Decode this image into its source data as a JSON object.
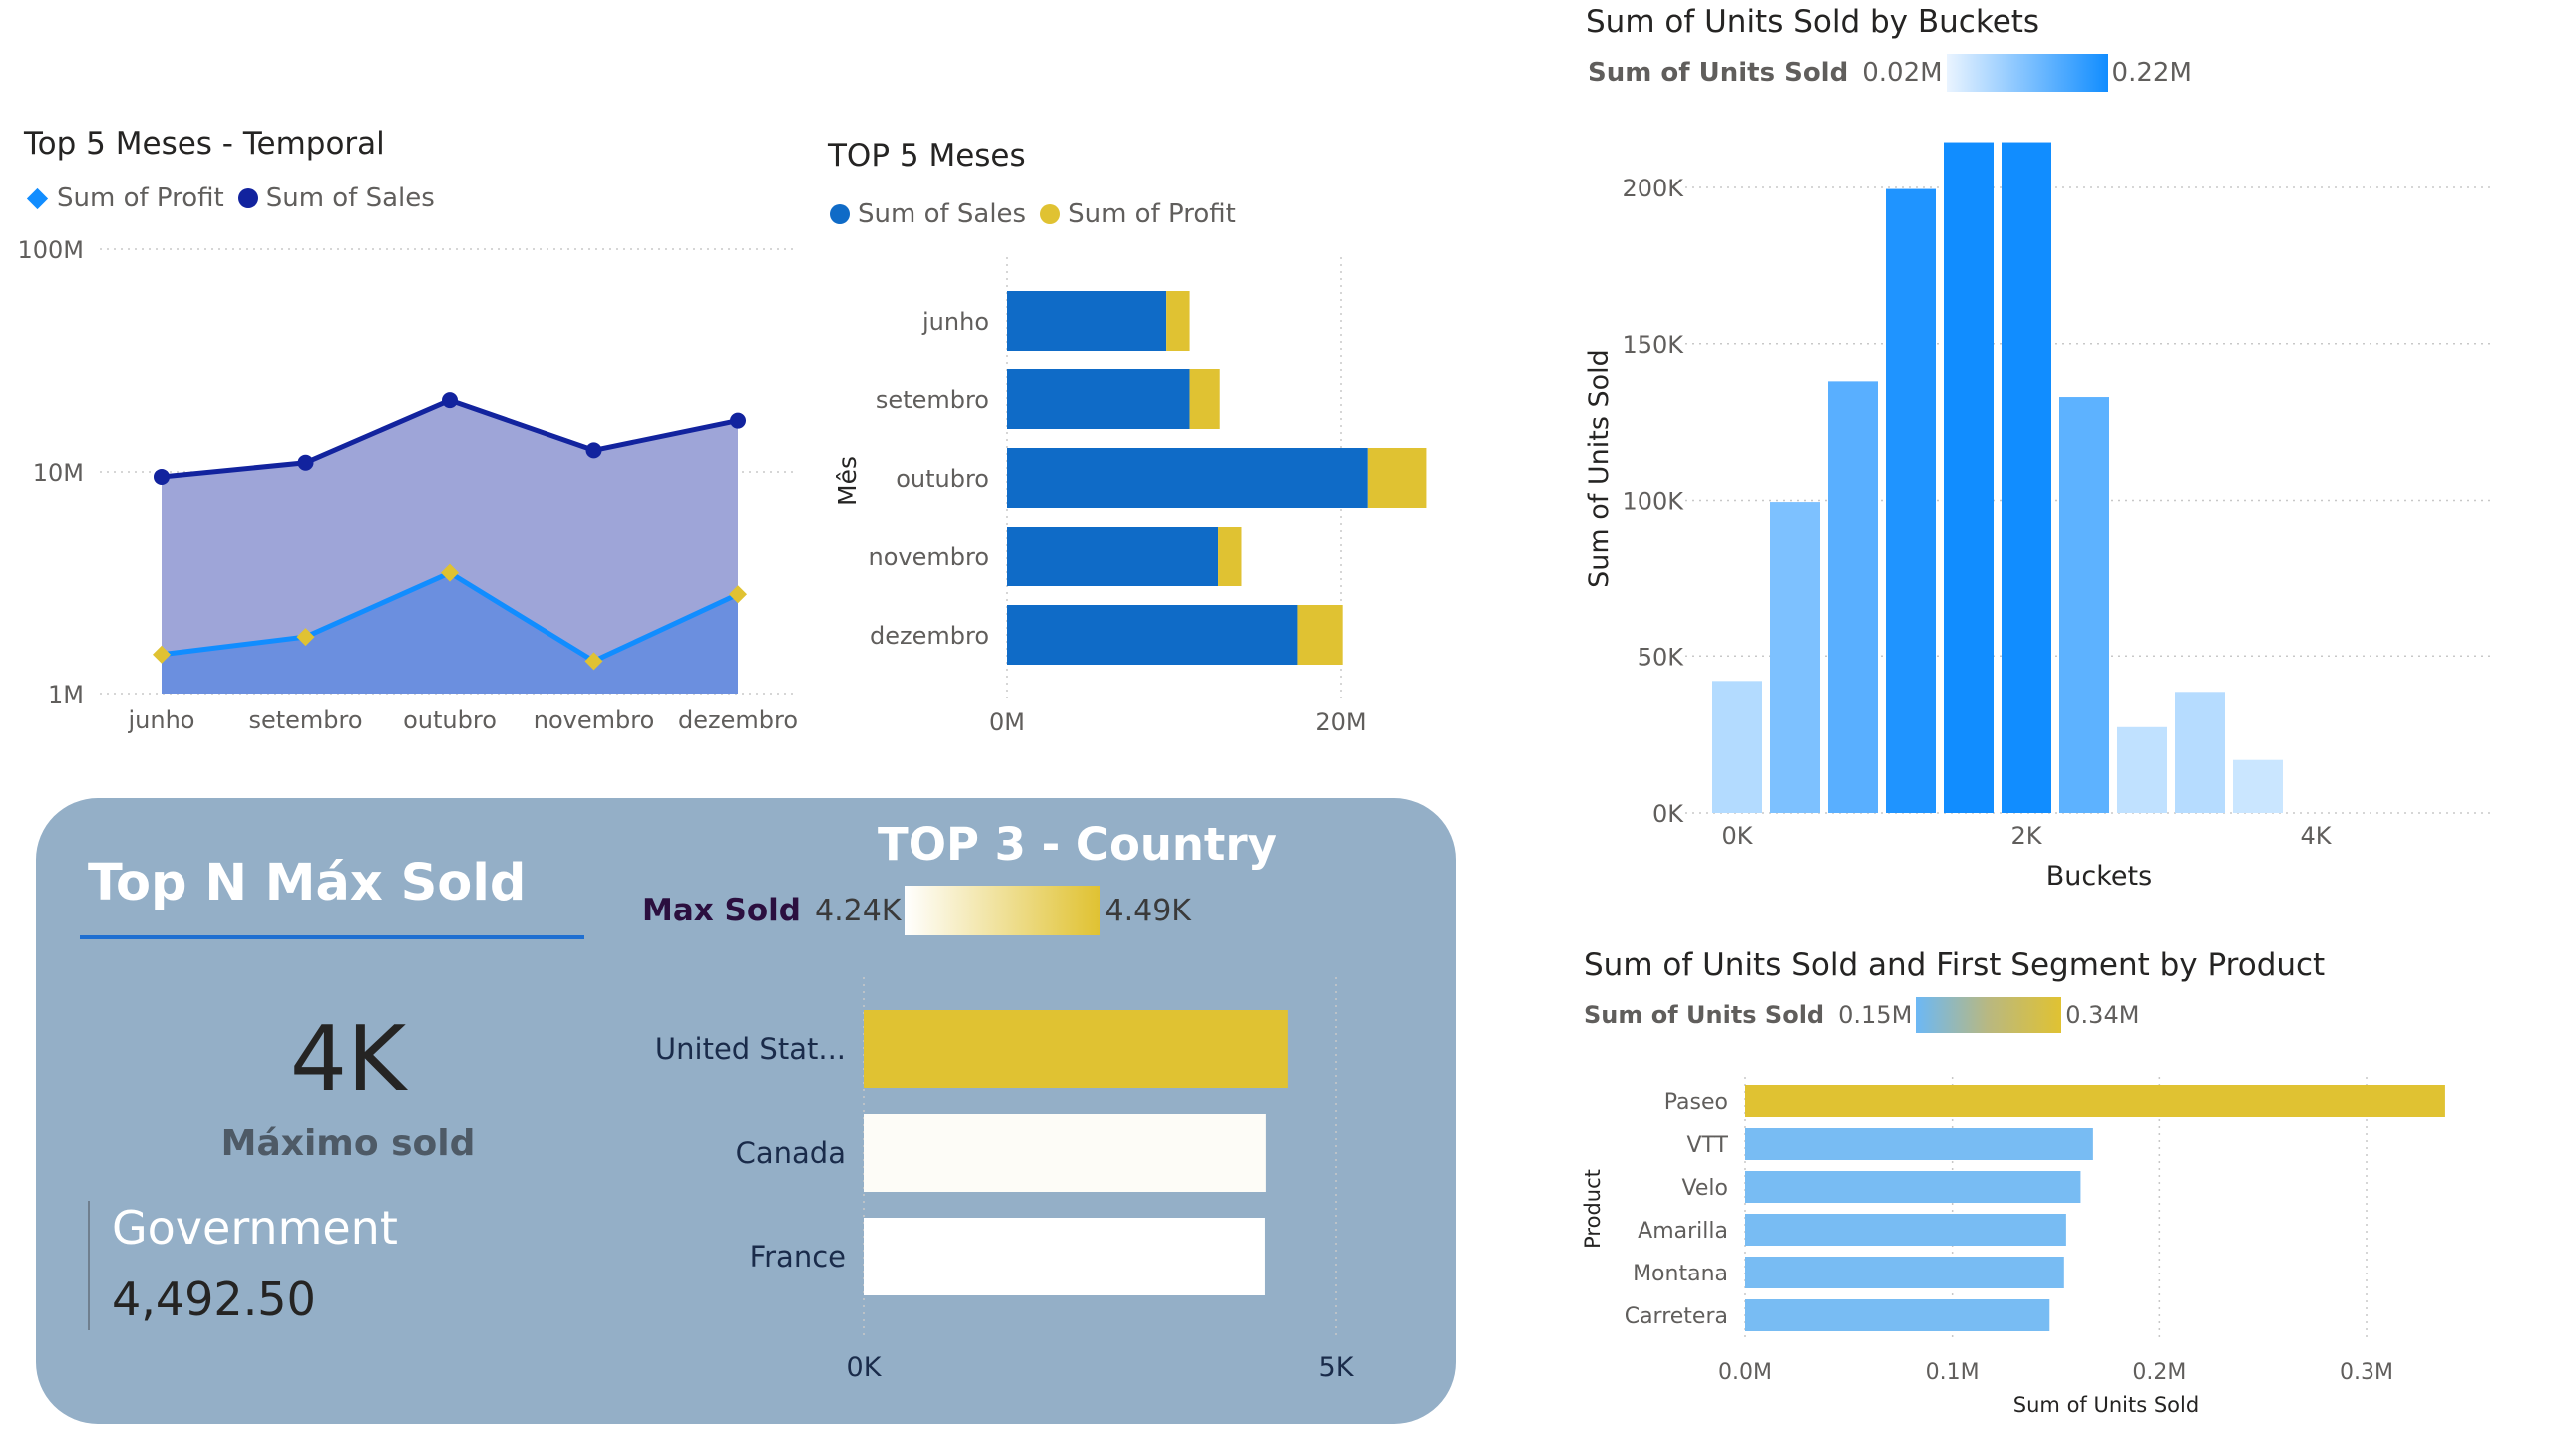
{
  "charts": {
    "temporal": {
      "title": "Top 5 Meses - Temporal",
      "legend": [
        {
          "name": "Sum of Profit",
          "color": "#118dff",
          "marker": "diamond"
        },
        {
          "name": "Sum of  Sales",
          "color": "#12239e",
          "marker": "circle"
        }
      ],
      "y_ticks": [
        "100M",
        "10M",
        "1M"
      ]
    },
    "top5": {
      "title": "TOP 5 Meses",
      "legend": [
        {
          "name": "Sum of  Sales",
          "color": "#0f6bc7"
        },
        {
          "name": "Sum of Profit",
          "color": "#e0c232"
        }
      ],
      "ylabel": "Mês",
      "x_ticks": [
        "0M",
        "20M"
      ]
    },
    "buckets": {
      "title": "Sum of Units Sold by Buckets",
      "legend_label": "Sum of Units Sold",
      "legend_min": "0.02M",
      "legend_max": "0.22M",
      "ylabel": "Sum of Units Sold",
      "xlabel": "Buckets",
      "y_ticks": [
        "200K",
        "150K",
        "100K",
        "50K",
        "0K"
      ],
      "x_ticks": [
        "0K",
        "2K",
        "4K"
      ]
    },
    "country": {
      "title": "TOP 3 - Country",
      "legend_label": "Max Sold",
      "legend_min": "4.24K",
      "legend_max": "4.49K",
      "x_ticks": [
        "0K",
        "5K"
      ]
    },
    "product": {
      "title": "Sum of Units Sold and First Segment by Product",
      "legend_label": "Sum of Units Sold",
      "legend_min": "0.15M",
      "legend_max": "0.34M",
      "ylabel": "Product",
      "xlabel": "Sum of Units Sold",
      "x_ticks": [
        "0.0M",
        "0.1M",
        "0.2M",
        "0.3M"
      ]
    }
  },
  "card": {
    "title": "Top N Máx Sold",
    "kpi_value": "4K",
    "kpi_label": "Máximo sold",
    "segment": "Government",
    "segment_value": "4,492.50"
  },
  "chart_data": [
    {
      "type": "area",
      "title": "Top 5 Meses - Temporal",
      "categories": [
        "junho",
        "setembro",
        "outubro",
        "novembro",
        "dezembro"
      ],
      "y_scale": "log",
      "ylim": [
        1000000,
        100000000
      ],
      "series": [
        {
          "name": "Sum of  Sales",
          "values": [
            9500000,
            11000000,
            21000000,
            12500000,
            17000000
          ]
        },
        {
          "name": "Sum of Profit",
          "values": [
            1500000,
            1800000,
            3500000,
            1400000,
            2800000
          ]
        }
      ],
      "legend_position": "top-left"
    },
    {
      "type": "bar",
      "orientation": "horizontal",
      "stacked": true,
      "title": "TOP 5 Meses",
      "ylabel": "Mês",
      "categories": [
        "junho",
        "setembro",
        "outubro",
        "novembro",
        "dezembro"
      ],
      "series": [
        {
          "name": "Sum of  Sales",
          "values": [
            9500000,
            10900000,
            21600000,
            12600000,
            17400000
          ]
        },
        {
          "name": "Sum of Profit",
          "values": [
            1400000,
            1800000,
            3500000,
            1400000,
            2700000
          ]
        }
      ],
      "xlim": [
        0,
        25000000
      ]
    },
    {
      "type": "bar",
      "title": "Sum of Units Sold by Buckets",
      "xlabel": "Buckets",
      "ylabel": "Sum of Units Sold",
      "x": [
        0,
        400,
        800,
        1200,
        1600,
        2000,
        2400,
        2800,
        3200,
        3600,
        4000
      ],
      "values": [
        42000,
        99500,
        138000,
        199500,
        214500,
        214500,
        133000,
        27500,
        38500,
        17000,
        0
      ],
      "xlim": [
        0,
        4500
      ],
      "ylim": [
        0,
        220000
      ],
      "grid": true
    },
    {
      "type": "bar",
      "orientation": "horizontal",
      "title": "TOP 3 - Country",
      "categories": [
        "United Stat...",
        "Canada",
        "France"
      ],
      "values": [
        4492.5,
        4250,
        4240
      ],
      "xlim": [
        0,
        5000
      ]
    },
    {
      "type": "bar",
      "orientation": "horizontal",
      "title": "Sum of Units Sold and First Segment by Product",
      "xlabel": "Sum of Units Sold",
      "ylabel": "Product",
      "categories": [
        "Paseo",
        "VTT",
        "Velo",
        "Amarilla",
        "Montana",
        "Carretera"
      ],
      "values": [
        338000,
        168000,
        162000,
        155000,
        154000,
        147000
      ],
      "xlim": [
        0,
        350000
      ]
    }
  ]
}
